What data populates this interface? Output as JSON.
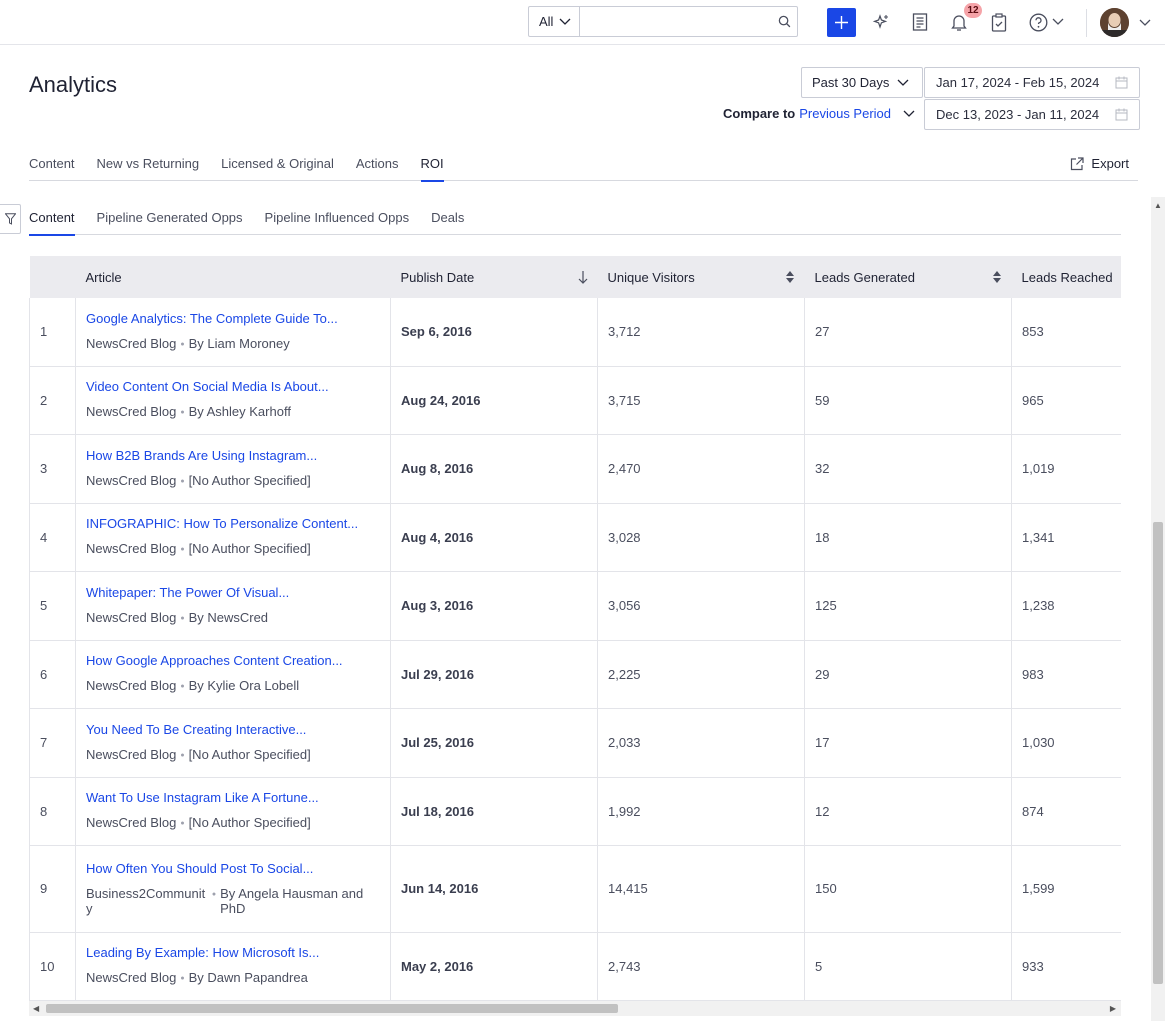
{
  "topbar": {
    "scope_label": "All",
    "search_placeholder": "",
    "notification_count": "12",
    "icons": [
      "plus-icon",
      "sparkle-icon",
      "document-list-icon",
      "bell-icon",
      "clipboard-check-icon",
      "help-icon",
      "avatar"
    ]
  },
  "header": {
    "title": "Analytics",
    "range_label": "Past 30 Days",
    "date_range": "Jan 17, 2024 - Feb 15, 2024",
    "compare_prefix": "Compare to",
    "compare_link": "Previous Period",
    "compare_range": "Dec 13, 2023 - Jan 11, 2024"
  },
  "tabs": [
    {
      "label": "Content",
      "active": false
    },
    {
      "label": "New vs Returning",
      "active": false
    },
    {
      "label": "Licensed & Original",
      "active": false
    },
    {
      "label": "Actions",
      "active": false
    },
    {
      "label": "ROI",
      "active": true
    }
  ],
  "export_label": "Export",
  "subtabs": [
    {
      "label": "Content",
      "active": true
    },
    {
      "label": "Pipeline Generated Opps",
      "active": false
    },
    {
      "label": "Pipeline Influenced Opps",
      "active": false
    },
    {
      "label": "Deals",
      "active": false
    }
  ],
  "table": {
    "columns": [
      "",
      "Article",
      "Publish Date",
      "Unique Visitors",
      "Leads Generated",
      "Leads Reached"
    ],
    "rows": [
      {
        "n": "1",
        "title": "Google Analytics: The Complete Guide To...",
        "source": "NewsCred Blog",
        "author": "By Liam Moroney",
        "date": "Sep 6, 2016",
        "visitors": "3,712",
        "leads": "27",
        "reached": "853"
      },
      {
        "n": "2",
        "title": "Video Content On Social Media Is About...",
        "source": "NewsCred Blog",
        "author": "By Ashley Karhoff",
        "date": "Aug 24, 2016",
        "visitors": "3,715",
        "leads": "59",
        "reached": "965"
      },
      {
        "n": "3",
        "title": "How B2B Brands Are Using Instagram...",
        "source": "NewsCred Blog",
        "author": "[No Author Specified]",
        "date": "Aug 8, 2016",
        "visitors": "2,470",
        "leads": "32",
        "reached": "1,019"
      },
      {
        "n": "4",
        "title": "INFOGRAPHIC: How To Personalize Content...",
        "source": "NewsCred Blog",
        "author": "[No Author Specified]",
        "date": "Aug 4, 2016",
        "visitors": "3,028",
        "leads": "18",
        "reached": "1,341"
      },
      {
        "n": "5",
        "title": "Whitepaper: The Power Of Visual...",
        "source": "NewsCred Blog",
        "author": "By NewsCred",
        "date": "Aug 3, 2016",
        "visitors": "3,056",
        "leads": "125",
        "reached": "1,238"
      },
      {
        "n": "6",
        "title": "How Google Approaches Content Creation...",
        "source": "NewsCred Blog",
        "author": "By Kylie Ora Lobell",
        "date": "Jul 29, 2016",
        "visitors": "2,225",
        "leads": "29",
        "reached": "983"
      },
      {
        "n": "7",
        "title": "You Need To Be Creating Interactive...",
        "source": "NewsCred Blog",
        "author": "[No Author Specified]",
        "date": "Jul 25, 2016",
        "visitors": "2,033",
        "leads": "17",
        "reached": "1,030"
      },
      {
        "n": "8",
        "title": "Want To Use Instagram Like A Fortune...",
        "source": "NewsCred Blog",
        "author": "[No Author Specified]",
        "date": "Jul 18, 2016",
        "visitors": "1,992",
        "leads": "12",
        "reached": "874"
      },
      {
        "n": "9",
        "title": "How Often You Should Post To Social...",
        "source": "Business2Community",
        "author": "By Angela Hausman and PhD",
        "date": "Jun 14, 2016",
        "visitors": "14,415",
        "leads": "150",
        "reached": "1,599"
      },
      {
        "n": "10",
        "title": "Leading By Example: How Microsoft Is...",
        "source": "NewsCred Blog",
        "author": "By Dawn Papandrea",
        "date": "May 2, 2016",
        "visitors": "2,743",
        "leads": "5",
        "reached": "933"
      }
    ]
  },
  "colors": {
    "accent": "#1a47e6",
    "header_bg": "#ebebef",
    "badge": "#f5a3a8"
  }
}
